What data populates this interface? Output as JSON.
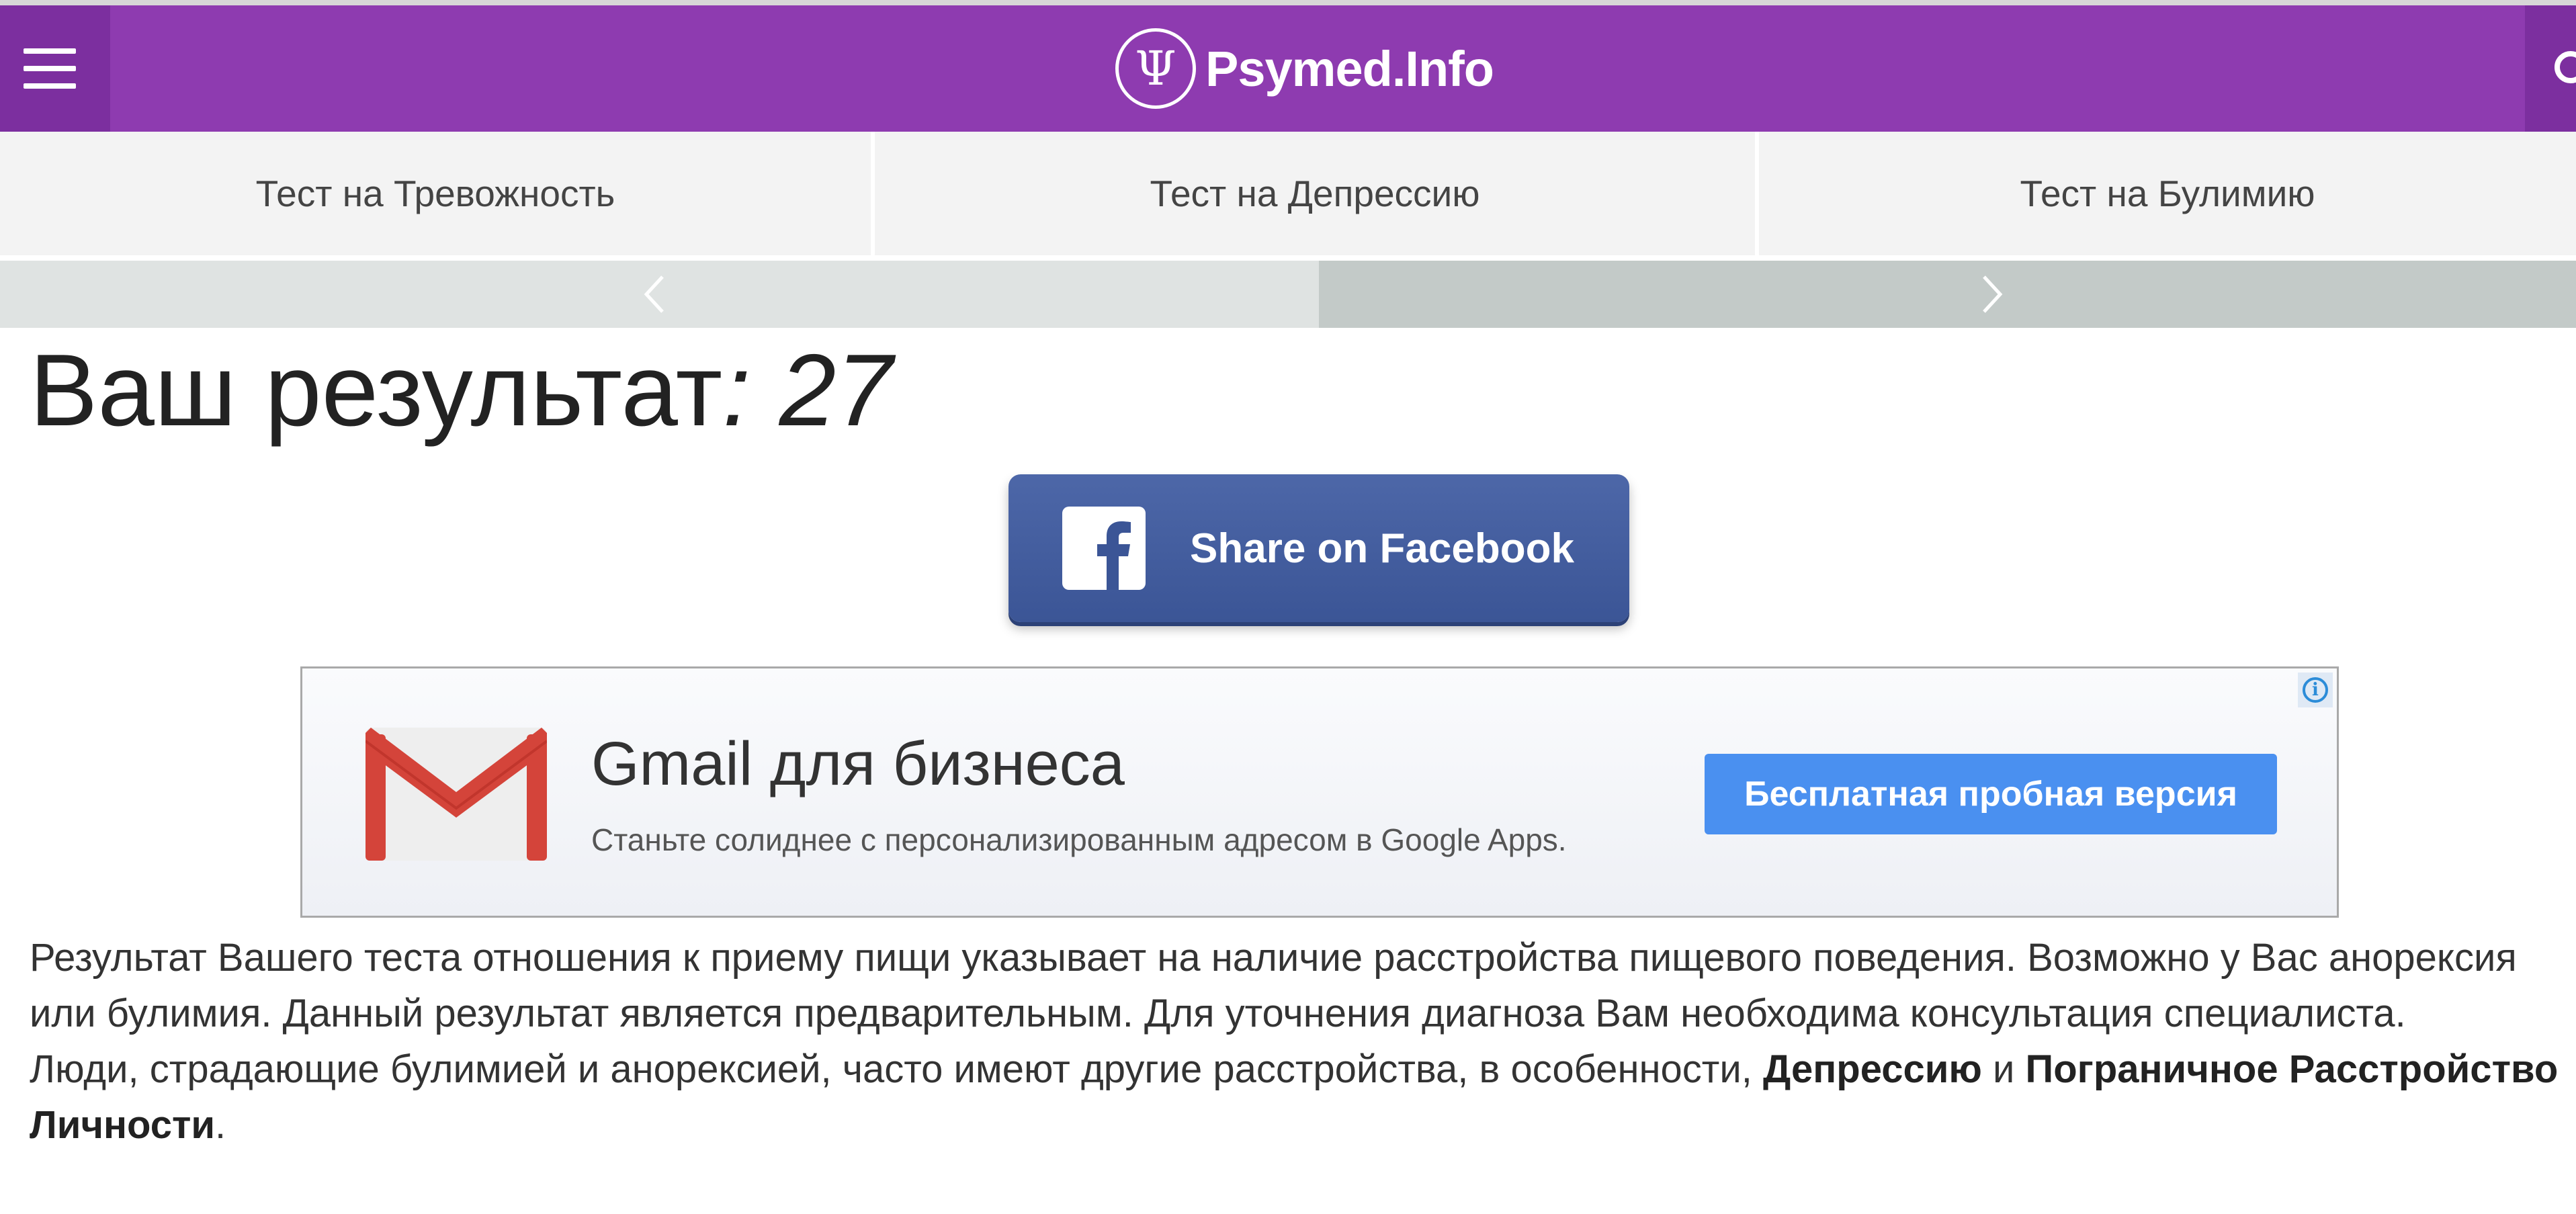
{
  "header": {
    "logo_symbol": "Ψ",
    "site_name": "Psymed.Info",
    "menu_icon": "hamburger-icon",
    "search_icon": "search-icon",
    "brand_color": "#8e3bb0"
  },
  "tabs": [
    {
      "label": "Тест на Тревожность"
    },
    {
      "label": "Тест на Депрессию"
    },
    {
      "label": "Тест на Булимию"
    }
  ],
  "carousel": {
    "prev_icon": "chevron-left-icon",
    "next_icon": "chevron-right-icon"
  },
  "result": {
    "label": "Ваш результат",
    "score": ": 27"
  },
  "share": {
    "label": "Share on Facebook",
    "icon": "facebook-icon",
    "color": "#3b5596"
  },
  "ad": {
    "title": "Gmail для бизнеса",
    "subtitle": "Станьте солиднее с персонализированным адресом в Google Apps.",
    "cta": "Бесплатная пробная версия",
    "info_icon": "info-icon",
    "logo_icon": "gmail-logo-icon",
    "cta_color": "#4a90f0"
  },
  "content": {
    "paragraph1": "Результат Вашего теста отношения к приему пищи указывает на наличие расстройства пищевого поведения. Возможно у Вас анорексия или булимия. Данный результат является предварительным. Для уточнения диагноза Вам необходима консультация специалиста.",
    "p2_text1": "Люди, страдающие булимией и анорексией, часто имеют другие расстройства, в особенности, ",
    "p2_link1": "Депрессию",
    "p2_text2": " и ",
    "p2_link2": "Пограничное Расстройство Личности",
    "p2_text3": "."
  }
}
